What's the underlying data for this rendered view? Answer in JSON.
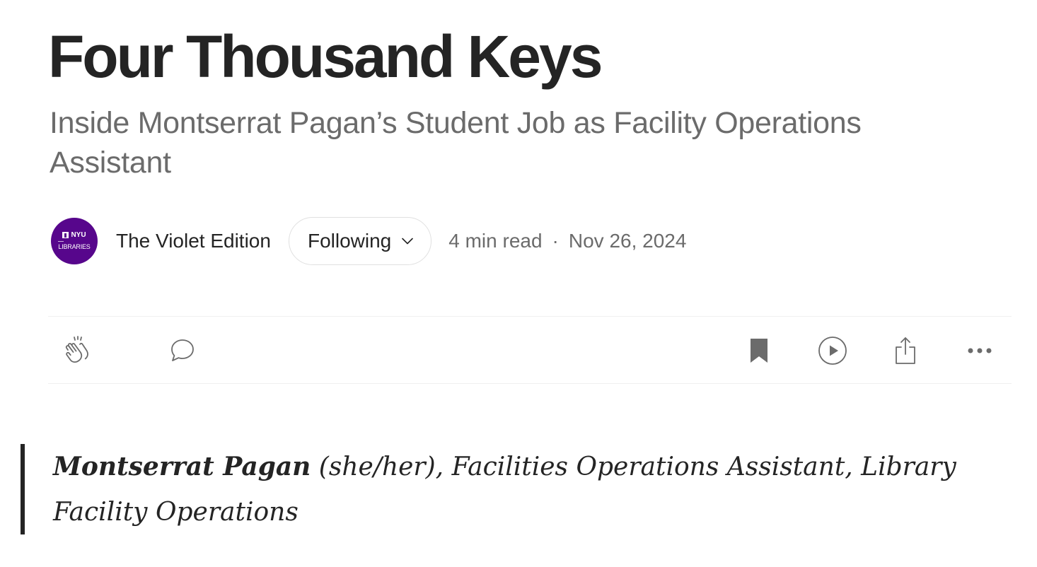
{
  "article": {
    "title": "Four Thousand Keys",
    "subtitle": "Inside Montserrat Pagan’s Student Job as Facility Operations Assistant"
  },
  "publication": {
    "name": "The Violet Edition",
    "avatar_top": "NYU",
    "avatar_bottom": "LIBRARIES",
    "brand_color": "#57068c"
  },
  "follow_button": {
    "label": "Following",
    "icon": "chevron-down-icon"
  },
  "meta": {
    "read_time": "4 min read",
    "separator": "·",
    "date": "Nov 26, 2024"
  },
  "action_bar": {
    "icons": [
      "clap-icon",
      "comment-icon",
      "bookmark-icon",
      "play-icon",
      "share-icon",
      "more-icon"
    ]
  },
  "quote": {
    "name": "Montserrat Pagan",
    "rest": " (she/her), Facilities Operations Assistant, Library Facility Operations"
  },
  "colors": {
    "text": "#242424",
    "muted": "#6b6b6b",
    "border": "#f0f0f0"
  }
}
